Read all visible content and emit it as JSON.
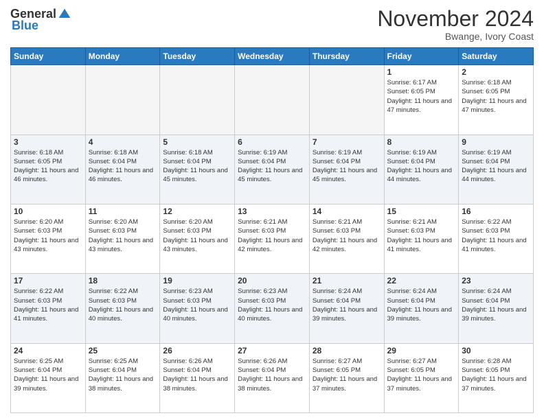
{
  "header": {
    "logo_general": "General",
    "logo_blue": "Blue",
    "month_title": "November 2024",
    "location": "Bwange, Ivory Coast"
  },
  "calendar": {
    "weekdays": [
      "Sunday",
      "Monday",
      "Tuesday",
      "Wednesday",
      "Thursday",
      "Friday",
      "Saturday"
    ],
    "weeks": [
      [
        {
          "day": "",
          "empty": true
        },
        {
          "day": "",
          "empty": true
        },
        {
          "day": "",
          "empty": true
        },
        {
          "day": "",
          "empty": true
        },
        {
          "day": "",
          "empty": true
        },
        {
          "day": "1",
          "sunrise": "6:17 AM",
          "sunset": "6:05 PM",
          "daylight": "11 hours and 47 minutes."
        },
        {
          "day": "2",
          "sunrise": "6:18 AM",
          "sunset": "6:05 PM",
          "daylight": "11 hours and 47 minutes."
        }
      ],
      [
        {
          "day": "3",
          "sunrise": "6:18 AM",
          "sunset": "6:05 PM",
          "daylight": "11 hours and 46 minutes."
        },
        {
          "day": "4",
          "sunrise": "6:18 AM",
          "sunset": "6:04 PM",
          "daylight": "11 hours and 46 minutes."
        },
        {
          "day": "5",
          "sunrise": "6:18 AM",
          "sunset": "6:04 PM",
          "daylight": "11 hours and 45 minutes."
        },
        {
          "day": "6",
          "sunrise": "6:19 AM",
          "sunset": "6:04 PM",
          "daylight": "11 hours and 45 minutes."
        },
        {
          "day": "7",
          "sunrise": "6:19 AM",
          "sunset": "6:04 PM",
          "daylight": "11 hours and 45 minutes."
        },
        {
          "day": "8",
          "sunrise": "6:19 AM",
          "sunset": "6:04 PM",
          "daylight": "11 hours and 44 minutes."
        },
        {
          "day": "9",
          "sunrise": "6:19 AM",
          "sunset": "6:04 PM",
          "daylight": "11 hours and 44 minutes."
        }
      ],
      [
        {
          "day": "10",
          "sunrise": "6:20 AM",
          "sunset": "6:03 PM",
          "daylight": "11 hours and 43 minutes."
        },
        {
          "day": "11",
          "sunrise": "6:20 AM",
          "sunset": "6:03 PM",
          "daylight": "11 hours and 43 minutes."
        },
        {
          "day": "12",
          "sunrise": "6:20 AM",
          "sunset": "6:03 PM",
          "daylight": "11 hours and 43 minutes."
        },
        {
          "day": "13",
          "sunrise": "6:21 AM",
          "sunset": "6:03 PM",
          "daylight": "11 hours and 42 minutes."
        },
        {
          "day": "14",
          "sunrise": "6:21 AM",
          "sunset": "6:03 PM",
          "daylight": "11 hours and 42 minutes."
        },
        {
          "day": "15",
          "sunrise": "6:21 AM",
          "sunset": "6:03 PM",
          "daylight": "11 hours and 41 minutes."
        },
        {
          "day": "16",
          "sunrise": "6:22 AM",
          "sunset": "6:03 PM",
          "daylight": "11 hours and 41 minutes."
        }
      ],
      [
        {
          "day": "17",
          "sunrise": "6:22 AM",
          "sunset": "6:03 PM",
          "daylight": "11 hours and 41 minutes."
        },
        {
          "day": "18",
          "sunrise": "6:22 AM",
          "sunset": "6:03 PM",
          "daylight": "11 hours and 40 minutes."
        },
        {
          "day": "19",
          "sunrise": "6:23 AM",
          "sunset": "6:03 PM",
          "daylight": "11 hours and 40 minutes."
        },
        {
          "day": "20",
          "sunrise": "6:23 AM",
          "sunset": "6:03 PM",
          "daylight": "11 hours and 40 minutes."
        },
        {
          "day": "21",
          "sunrise": "6:24 AM",
          "sunset": "6:04 PM",
          "daylight": "11 hours and 39 minutes."
        },
        {
          "day": "22",
          "sunrise": "6:24 AM",
          "sunset": "6:04 PM",
          "daylight": "11 hours and 39 minutes."
        },
        {
          "day": "23",
          "sunrise": "6:24 AM",
          "sunset": "6:04 PM",
          "daylight": "11 hours and 39 minutes."
        }
      ],
      [
        {
          "day": "24",
          "sunrise": "6:25 AM",
          "sunset": "6:04 PM",
          "daylight": "11 hours and 39 minutes."
        },
        {
          "day": "25",
          "sunrise": "6:25 AM",
          "sunset": "6:04 PM",
          "daylight": "11 hours and 38 minutes."
        },
        {
          "day": "26",
          "sunrise": "6:26 AM",
          "sunset": "6:04 PM",
          "daylight": "11 hours and 38 minutes."
        },
        {
          "day": "27",
          "sunrise": "6:26 AM",
          "sunset": "6:04 PM",
          "daylight": "11 hours and 38 minutes."
        },
        {
          "day": "28",
          "sunrise": "6:27 AM",
          "sunset": "6:05 PM",
          "daylight": "11 hours and 37 minutes."
        },
        {
          "day": "29",
          "sunrise": "6:27 AM",
          "sunset": "6:05 PM",
          "daylight": "11 hours and 37 minutes."
        },
        {
          "day": "30",
          "sunrise": "6:28 AM",
          "sunset": "6:05 PM",
          "daylight": "11 hours and 37 minutes."
        }
      ]
    ]
  }
}
